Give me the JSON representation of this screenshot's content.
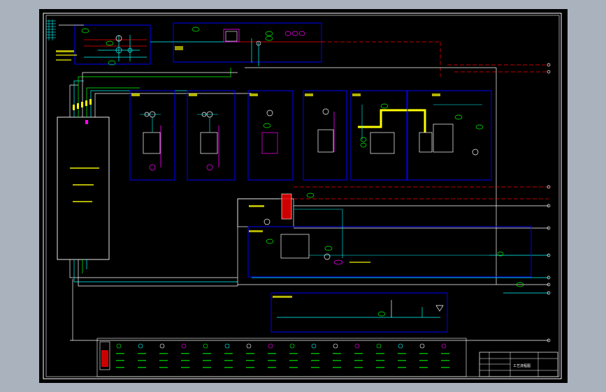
{
  "drawing": {
    "background": "#000000",
    "frame_color": "#ffffff",
    "title_block_text": "工艺流程图"
  },
  "colors": {
    "box": "#0000ff",
    "pipe_green": "#00ff00",
    "pipe_cyan": "#00ffff",
    "pipe_red": "#ff0000",
    "pipe_white": "#ffffff",
    "pipe_yellow": "#ffff00",
    "pipe_magenta": "#ff00ff",
    "label_yellow": "#ffff00"
  },
  "legend": {
    "title": "",
    "entries": 16
  }
}
